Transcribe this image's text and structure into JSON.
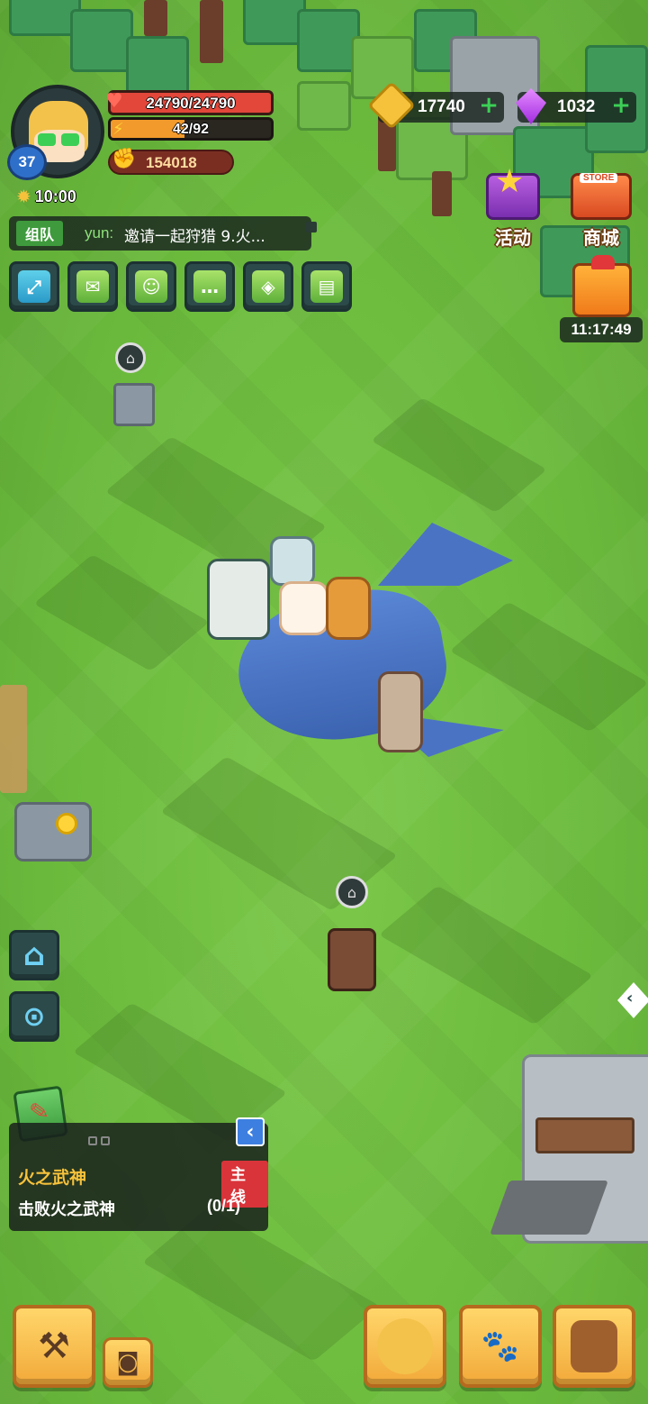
{
  "player": {
    "level": "37",
    "hp": "24790/24790",
    "energy": "42/92",
    "power": "154018",
    "time": "10:00"
  },
  "currency": {
    "gold": "17740",
    "gems": "1032"
  },
  "chat": {
    "channel": "组队",
    "sender": "yun:",
    "message": "邀请一起狩猎 9.火..."
  },
  "top_right": {
    "events_label": "活动",
    "store_label": "商城",
    "store_sign": "STORE",
    "gift_timer": "11:17:49"
  },
  "quick_buttons": [
    {
      "name": "expand-icon"
    },
    {
      "name": "mail-icon"
    },
    {
      "name": "friends-icon"
    },
    {
      "name": "chat-bubble-icon"
    },
    {
      "name": "map-icon"
    },
    {
      "name": "notice-board-icon"
    }
  ],
  "quest": {
    "title": "火之武神",
    "tag": "主线",
    "objective": "击败火之武神",
    "progress": "(0/1)"
  },
  "colors": {
    "hp_bar": "#e2473a",
    "energy_bar": "#f29a2b",
    "quest_tag": "#d9343a",
    "chat_channel": "#3e9a3c",
    "hud_button": "#2c4a4a"
  }
}
